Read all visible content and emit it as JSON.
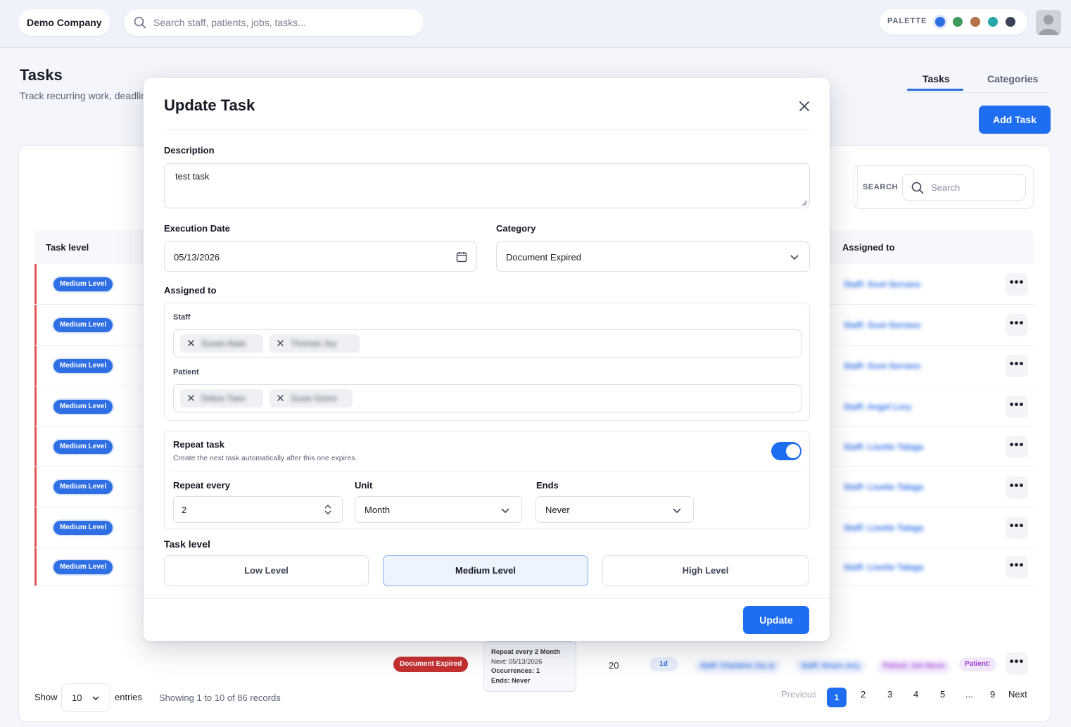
{
  "topbar": {
    "company": "Demo Company",
    "search_placeholder": "Search staff, patients, jobs, tasks...",
    "palette_label": "PALETTE",
    "palette_colors": [
      "#2f6fe4",
      "#3f9a5c",
      "#b5704a",
      "#2aa6a6",
      "#3a4258"
    ]
  },
  "page": {
    "title": "Tasks",
    "subtitle": "Track recurring work, deadline",
    "tabs": [
      "Tasks",
      "Categories"
    ],
    "add_task": "Add Task"
  },
  "filters": {
    "search_label": "SEARCH",
    "search_placeholder": "Search"
  },
  "table": {
    "headers": {
      "task_level": "Task level",
      "assigned_to": "Assigned to"
    },
    "rows": [
      {
        "level": "Medium Level",
        "assigned": "Staff: Soot Serrano"
      },
      {
        "level": "Medium Level",
        "assigned": "Staff: Soot Serrano"
      },
      {
        "level": "Medium Level",
        "assigned": "Staff: Soot Serrano"
      },
      {
        "level": "Medium Level",
        "assigned": "Staff: Angel Lory"
      },
      {
        "level": "Medium Level",
        "assigned": "Staff: Lisette Talaga"
      },
      {
        "level": "Medium Level",
        "assigned": "Staff: Lisette Talaga"
      },
      {
        "level": "Medium Level",
        "assigned": "Staff: Lisette Talaga"
      },
      {
        "level": "Medium Level",
        "assigned": "Staff: Lisette Talaga"
      }
    ],
    "more_label": "•••",
    "last_row": {
      "category": "Document Expired",
      "repeat_title": "Repeat every 2 Month",
      "next": "Next: 05/13/2026",
      "occurrences": "Occurrences: 1",
      "ends": "Ends: Never",
      "count": "20",
      "duration": "1d",
      "staff1": "Staff: Charlaine Joy ar",
      "staff2": "Staff: Alvaro Jory",
      "patient1": "Patient: Jcb Heree",
      "patient2": "Patient:"
    }
  },
  "footer": {
    "show": "Show",
    "entries_value": "10",
    "entries": "entries",
    "showing": "Showing 1 to 10 of 86 records",
    "previous": "Previous",
    "pages": [
      "1",
      "2",
      "3",
      "4",
      "5",
      "...",
      "9"
    ],
    "next": "Next"
  },
  "modal": {
    "title": "Update Task",
    "description_label": "Description",
    "description_value": "test task",
    "execution_date_label": "Execution Date",
    "execution_date_value": "05/13/2026",
    "category_label": "Category",
    "category_value": "Document Expired",
    "assigned_label": "Assigned to",
    "staff_label": "Staff",
    "staff": [
      "Susan Alaie",
      "Thomas Joy"
    ],
    "patient_label": "Patient",
    "patients": [
      "Debra Tiare",
      "Susie Gomo"
    ],
    "repeat_title": "Repeat task",
    "repeat_desc": "Create the next task automatically after this one expires.",
    "repeat_enabled": true,
    "repeat_every_label": "Repeat every",
    "repeat_every_value": "2",
    "unit_label": "Unit",
    "unit_value": "Month",
    "ends_label": "Ends",
    "ends_value": "Never",
    "task_level_label": "Task level",
    "levels": [
      "Low Level",
      "Medium Level",
      "High Level"
    ],
    "selected_level": "Medium Level",
    "update_button": "Update"
  }
}
